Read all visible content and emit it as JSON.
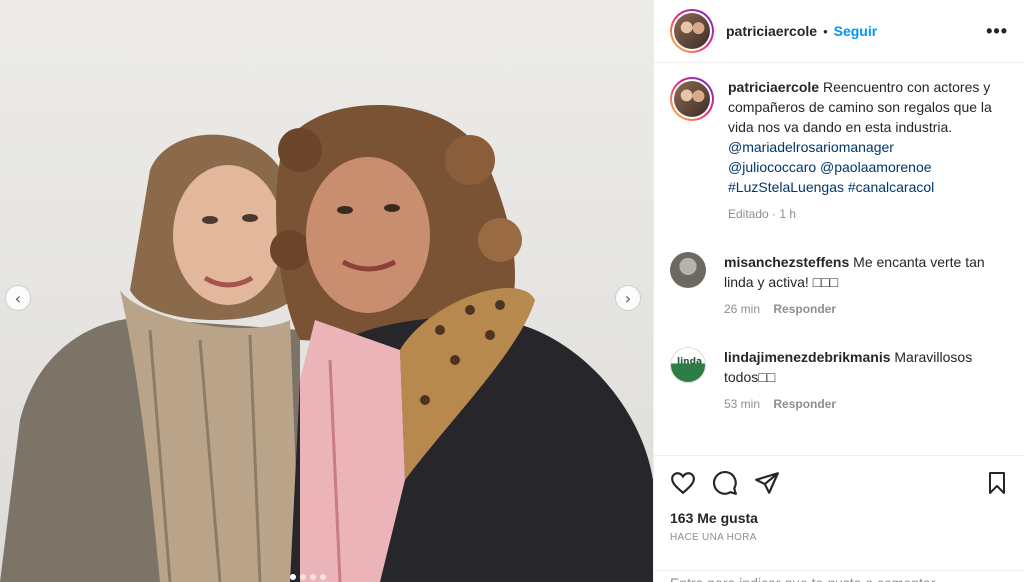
{
  "post": {
    "username": "patriciaercole",
    "separator": "•",
    "follow_label": "Seguir",
    "more_icon": "•••"
  },
  "carousel": {
    "prev_icon": "‹",
    "next_icon": "›",
    "slide_count": 4,
    "active_slide": 1
  },
  "caption": {
    "username": "patriciaercole",
    "text": "Reencuentro con actores y compañeros de camino son regalos que la vida nos va dando en esta industria.",
    "mentions_line1": "@mariadelrosariomanager",
    "mentions_line2": "@juliococcaro @paolaamorenoe",
    "hashtags": "#LuzStelaLuengas #canalcaracol",
    "edited": "Editado · 1 h"
  },
  "comments": [
    {
      "username": "misanchezsteffens",
      "text": "Me encanta verte tan linda y activa! □□□",
      "time": "26 min",
      "reply_label": "Responder"
    },
    {
      "username": "lindajimenezdebrikmanis",
      "text": "Maravillosos todos□□",
      "time": "53 min",
      "reply_label": "Responder",
      "avatar_text": "linda"
    }
  ],
  "actions": {
    "like_icon": "heart-icon",
    "comment_icon": "comment-icon",
    "share_icon": "paper-plane-icon",
    "save_icon": "bookmark-icon",
    "likes": "163 Me gusta",
    "time_ago": "HACE UNA HORA"
  },
  "add_comment": {
    "placeholder": "Entra para indicar que te gusta o comentar..."
  },
  "colors": {
    "accent": "#0095f6",
    "mention": "#00376b",
    "muted": "#8e8e8e"
  }
}
